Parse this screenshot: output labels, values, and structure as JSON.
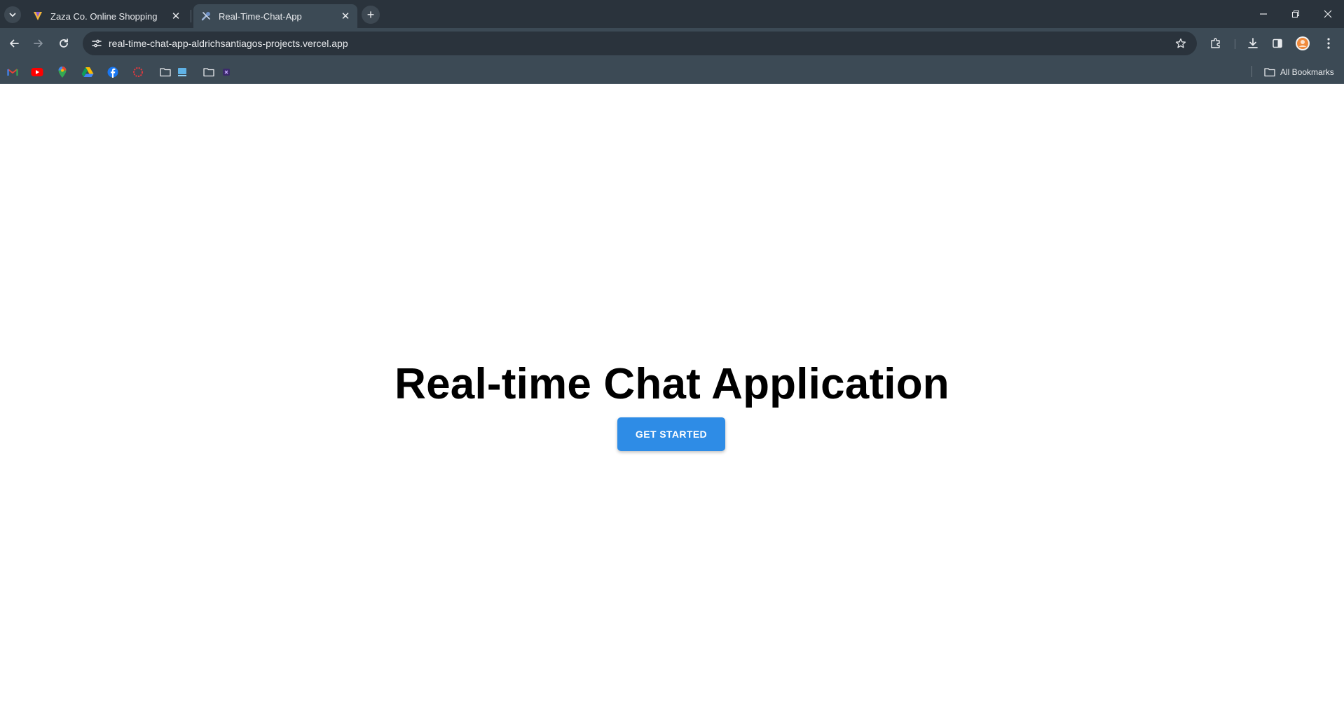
{
  "browser": {
    "tabs": [
      {
        "title": "Zaza Co. Online Shopping",
        "active": false,
        "favicon": "zaza-logo-icon"
      },
      {
        "title": "Real-Time-Chat-App",
        "active": true,
        "favicon": "tools-icon"
      }
    ],
    "address_bar": {
      "url": "real-time-chat-app-aldrichsantiagos-projects.vercel.app"
    },
    "bookmarks": {
      "icons": [
        "gmail-icon",
        "youtube-icon",
        "maps-icon",
        "drive-icon",
        "facebook-icon",
        "circle-icon",
        "folder-icon",
        "app-icon",
        "folder-icon",
        "extension-icon"
      ],
      "all_label": "All Bookmarks"
    }
  },
  "page": {
    "title": "Real-time Chat Application",
    "cta_label": "GET STARTED"
  },
  "colors": {
    "tabstrip_bg": "#2a333c",
    "toolbar_bg": "#3c4a55",
    "cta_bg": "#2e8ce6",
    "title_text": "#000000"
  }
}
